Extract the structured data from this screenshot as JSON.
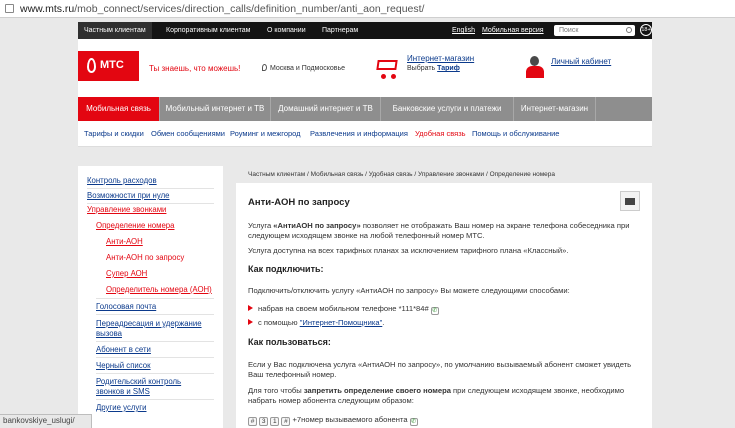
{
  "browser": {
    "url_host": "www.mts.ru",
    "url_path": "/mob_connect/services/direction_calls/definition_number/anti_aon_request/"
  },
  "topnav": {
    "items": [
      "Частным клиентам",
      "Корпоративным клиентам",
      "О компании",
      "Партнерам"
    ],
    "english": "English",
    "mobile_version": "Мобильная версия",
    "search_placeholder": "Поиск",
    "age": "18+"
  },
  "header": {
    "logo_text": "МТС",
    "slogan": "Ты знаешь, что можешь!",
    "region": "Москва и Подмосковье",
    "shop_link": "Интернет-магазин",
    "shop_prefix": "Выбрать ",
    "shop_tariff": "Тариф",
    "cabinet": "Личный кабинет"
  },
  "mainnav": {
    "tabs": [
      "Мобильная связь",
      "Мобильный интернет и ТВ",
      "Домашний интернет и ТВ",
      "Банковские услуги и платежи",
      "Интернет-магазин"
    ]
  },
  "subnav": {
    "links": [
      "Тарифы и скидки",
      "Обмен сообщениями",
      "Роуминг и межгород",
      "Развлечения и информация",
      "Удобная связь",
      "Помощь и обслуживание"
    ]
  },
  "sidebar": {
    "items": [
      "Контроль расходов",
      "Возможности при нуле",
      "Управление звонками",
      "Определение номера",
      "Анти-АОН",
      "Анти-АОН по запросу",
      "Супер АОН",
      "Определитель номера (АОН)",
      "Голосовая почта",
      "Переадресация и удержание",
      "вызова",
      "Абонент в сети",
      "Черный список",
      "Родительский контроль",
      "звонков и SMS",
      "Другие услуги"
    ]
  },
  "breadcrumb": "Частным клиентам / Мобильная связь / Удобная связь / Управление звонками / Определение номера",
  "content": {
    "title": "Анти-АОН по запросу",
    "p1_pre": "Услуга ",
    "p1_bold": "«АнтиАОН по запросу»",
    "p1_post": " позволяет не отображать Ваш номер на экране телефона собеседника при следующем исходящем звонке на любой телефонный номер МТС.",
    "p2": "Услуга доступна на всех тарифных планах за исключением тарифного плана «Классный».",
    "h_connect": "Как подключить:",
    "p3": "Подключить/отключить услугу «АнтиАОН по запросу» Вы можете следующими способами:",
    "bullet1": "набрав на своем мобильном телефоне *111*84#",
    "bullet2_pre": "с помощью ",
    "bullet2_link": "\"Интернет-Помощника\"",
    "bullet2_post": ".",
    "h_use": "Как пользоваться:",
    "p4": "Если у Вас подключена услуга «АнтиАОН по запросу», по умолчанию вызываемый абонент сможет увидеть Ваш телефонный номер.",
    "p5_pre": "Для того чтобы ",
    "p5_bold": "запретить определение своего номера",
    "p5_post": " при следующем исходящем звонке, необходимо набрать номер абонента следующим образом:",
    "keys": [
      "#",
      "3",
      "1",
      "#"
    ],
    "keys_suffix": "+7номер вызываемого абонента",
    "call_symbol": "✆"
  },
  "statusbar": "bankovskiye_uslugi/"
}
